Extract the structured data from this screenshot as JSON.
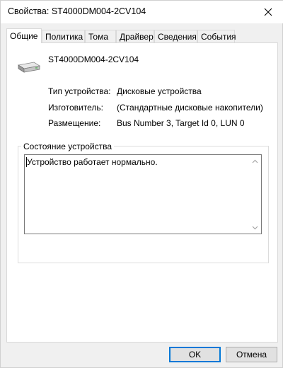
{
  "window": {
    "title": "Свойства: ST4000DM004-2CV104"
  },
  "tabs": [
    {
      "label": "Общие",
      "active": true
    },
    {
      "label": "Политика",
      "active": false
    },
    {
      "label": "Тома",
      "active": false
    },
    {
      "label": "Драйвер",
      "active": false
    },
    {
      "label": "Сведения",
      "active": false
    },
    {
      "label": "События",
      "active": false
    }
  ],
  "device": {
    "name": "ST4000DM004-2CV104",
    "icon": "hard-drive-icon"
  },
  "properties": [
    {
      "label": "Тип устройства:",
      "value": "Дисковые устройства"
    },
    {
      "label": "Изготовитель:",
      "value": "(Стандартные дисковые накопители)"
    },
    {
      "label": "Размещение:",
      "value": "Bus Number 3, Target Id 0, LUN 0"
    }
  ],
  "status": {
    "legend": "Состояние устройства",
    "text": "Устройство работает нормально."
  },
  "buttons": {
    "ok": "OK",
    "cancel": "Отмена"
  },
  "colors": {
    "accent": "#0078d7",
    "window_bg": "#f0f0f0",
    "panel_bg": "#ffffff"
  }
}
